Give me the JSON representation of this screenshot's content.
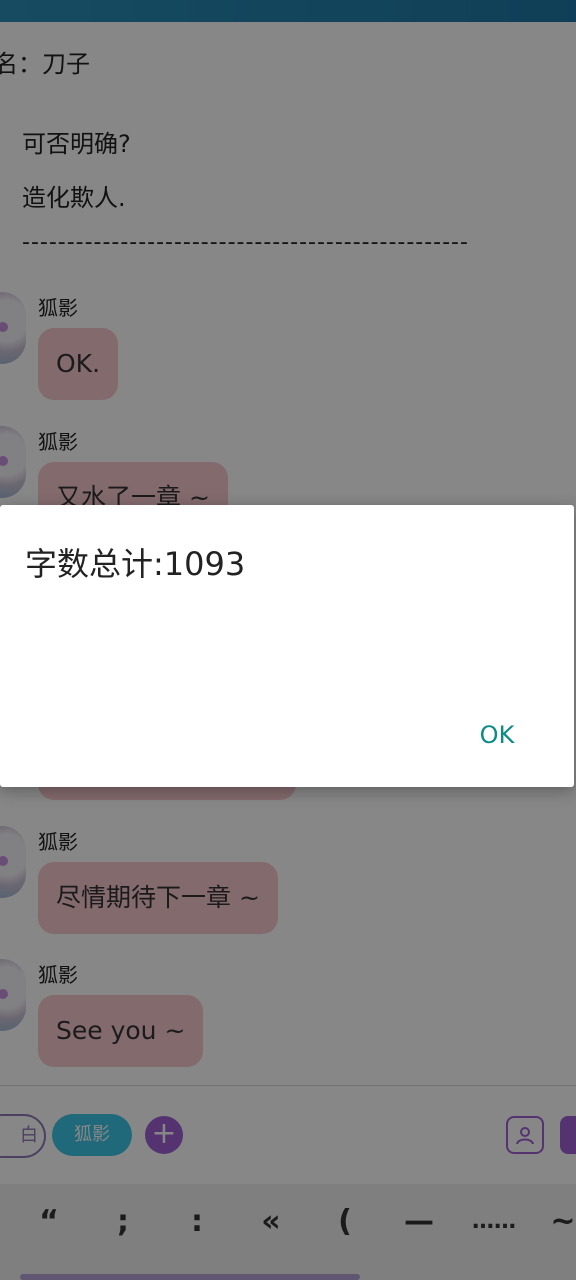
{
  "story": {
    "header_line": "名：刀子",
    "line1": "可否明确?",
    "line2": "造化欺人.",
    "separator": "--------------------------------------------------"
  },
  "messages": [
    {
      "sender": "狐影",
      "text": "OK."
    },
    {
      "sender": "狐影",
      "text": "又水了一章 ~"
    },
    {
      "sender": "狐影",
      "text": "尽情期待下一章 ~"
    },
    {
      "sender": "狐影",
      "text": "See you ~"
    }
  ],
  "role_bar": {
    "chip_left": "白",
    "chip_active": "狐影",
    "add_icon": "plus-icon",
    "profile_icon": "person-card-icon"
  },
  "symbols": {
    "items": [
      "“",
      ";",
      ":",
      "«",
      "(",
      "—",
      "……",
      "~"
    ]
  },
  "dialog": {
    "title": "字数总计:1093",
    "ok_label": "OK"
  },
  "colors": {
    "bubble": "#f7c9cf",
    "accent_purple": "#a061d6",
    "accent_cyan": "#3dc6e6",
    "ok_teal": "#0c8b87"
  }
}
